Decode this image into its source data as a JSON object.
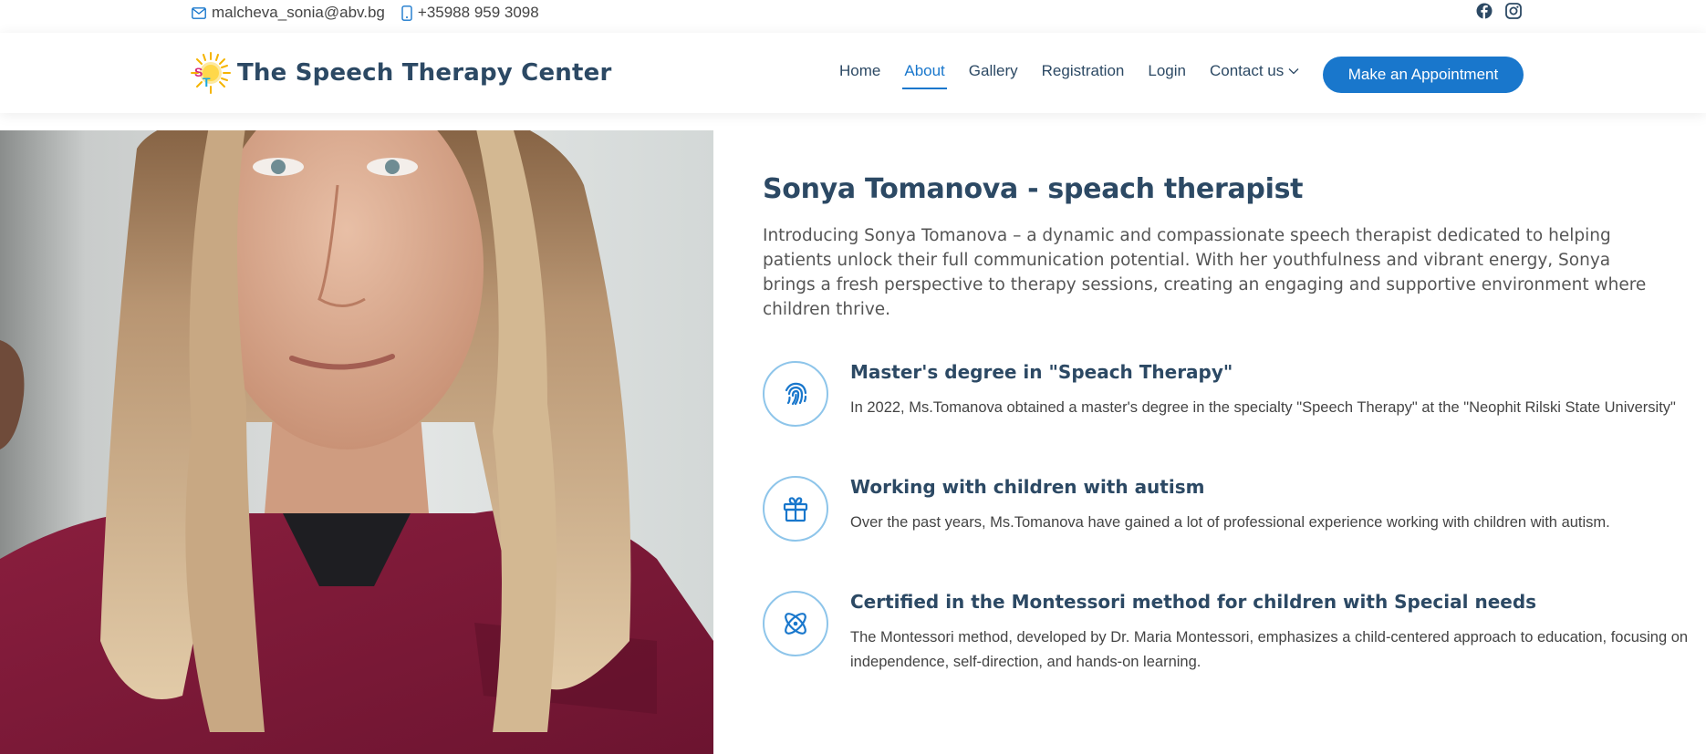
{
  "topbar": {
    "email": "malcheva_sonia@abv.bg",
    "phone": "+35988 959 3098",
    "social": [
      "facebook-icon",
      "instagram-icon"
    ]
  },
  "header": {
    "logo_text": "The Speech Therapy Center",
    "logo_letters": [
      "S",
      "T"
    ],
    "nav": {
      "home": "Home",
      "about": "About",
      "gallery": "Gallery",
      "registration": "Registration",
      "login": "Login",
      "contact": "Contact us"
    },
    "cta": "Make an Appointment"
  },
  "about": {
    "title": "Sonya Tomanova - speach therapist",
    "intro": "Introducing Sonya Tomanova – a dynamic and compassionate speech therapist dedicated to helping patients unlock their full communication potential. With her youthfulness and vibrant energy, Sonya brings a fresh perspective to therapy sessions, creating an engaging and supportive environment where children thrive.",
    "features": [
      {
        "icon": "fingerprint-icon",
        "title": "Master's degree in \"Speach Therapy\"",
        "desc": "In 2022, Ms.Tomanova obtained a master's degree in the specialty \"Speech Therapy\" at the \"Neophit Rilski State University\""
      },
      {
        "icon": "gift-icon",
        "title": "Working with children with autism",
        "desc": "Over the past years, Ms.Tomanova have gained a lot of professional experience working with children with autism."
      },
      {
        "icon": "atom-icon",
        "title": "Certified in the Montessori method for children with Special needs",
        "desc": "The Montessori method, developed by Dr. Maria Montessori, emphasizes a child-centered approach to education, focusing on independence, self-direction, and hands-on learning."
      }
    ]
  },
  "colors": {
    "primary": "#1977cc",
    "heading": "#2c4964",
    "icon_border": "#8ec5ea"
  }
}
